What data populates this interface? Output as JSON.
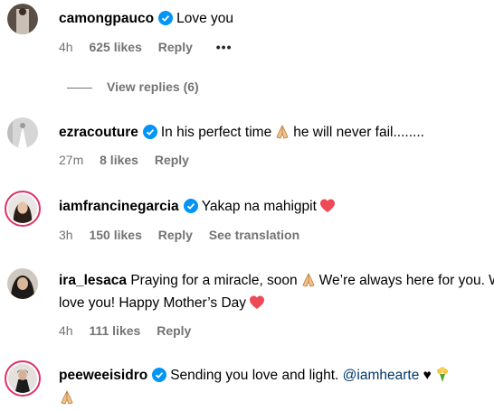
{
  "comments": [
    {
      "username": "camongpauco",
      "text_before": "Love you",
      "time": "4h",
      "likes": "625 likes",
      "reply": "Reply",
      "more": "•••"
    },
    {
      "username": "ezracouture",
      "text_before": "In his perfect time",
      "text_after": "he will never fail........",
      "time": "27m",
      "likes": "8 likes",
      "reply": "Reply"
    },
    {
      "username": "iamfrancinegarcia",
      "text_before": "Yakap na mahigpit",
      "time": "3h",
      "likes": "150 likes",
      "reply": "Reply",
      "see_translation": "See translation"
    },
    {
      "username": "ira_lesaca",
      "text_before": "Praying for a miracle, soon",
      "text_after": "We’re always here for you. We love you! Happy Mother’s Day",
      "time": "4h",
      "likes": "111 likes",
      "reply": "Reply"
    },
    {
      "username": "peeweeisidro",
      "text_before": "Sending you love and light.",
      "mention": "@iamhearte"
    }
  ],
  "view_replies": "View replies (6)",
  "colors": {
    "meta": "#737373",
    "verified": "#0095f6",
    "heart": "#ed4956",
    "mention": "#00376b"
  }
}
